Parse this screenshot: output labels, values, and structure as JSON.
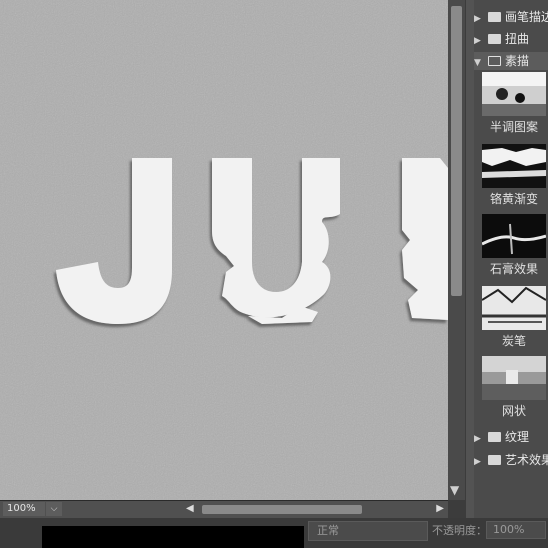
{
  "canvas": {
    "letters": [
      "J",
      "U",
      "N"
    ]
  },
  "status": {
    "zoom": "100%"
  },
  "layers": {
    "blend_mode": "正常",
    "opacity_label": "不透明度：",
    "opacity_value": "100%"
  },
  "filter_gallery": {
    "categories": [
      {
        "label": "画笔描边",
        "expanded": false
      },
      {
        "label": "扭曲",
        "expanded": false
      },
      {
        "label": "素描",
        "expanded": true
      },
      {
        "label": "纹理",
        "expanded": false
      },
      {
        "label": "艺术效果",
        "expanded": false
      }
    ],
    "sketch_filters": [
      {
        "label": "半调图案"
      },
      {
        "label": "铬黄渐变"
      },
      {
        "label": "石膏效果"
      },
      {
        "label": "炭笔"
      },
      {
        "label": "网状"
      }
    ]
  },
  "colors": {
    "canvas_bg": "#a9a9a9",
    "letter_fill": "#f2f2f2",
    "panel_bg": "#4b4b4b"
  }
}
